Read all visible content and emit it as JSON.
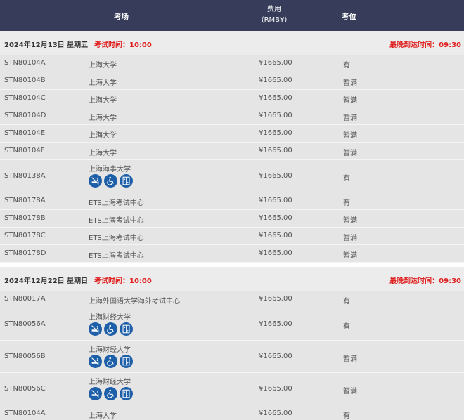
{
  "header": {
    "venue": "考场",
    "fee_line1": "费用",
    "fee_line2": "(RMB¥)",
    "seat": "考位"
  },
  "days": [
    {
      "date": "2024年12月13日 星期五",
      "exam_time": "考试时间：10:00",
      "latest_arrival": "最晚到达时间：09:30",
      "rows": [
        {
          "code": "STN80104A",
          "venue": "上海大学",
          "fee": "¥1665.00",
          "seat": "有",
          "icons": []
        },
        {
          "code": "STN80104B",
          "venue": "上海大学",
          "fee": "¥1665.00",
          "seat": "暂满",
          "icons": []
        },
        {
          "code": "STN80104C",
          "venue": "上海大学",
          "fee": "¥1665.00",
          "seat": "暂满",
          "icons": []
        },
        {
          "code": "STN80104D",
          "venue": "上海大学",
          "fee": "¥1665.00",
          "seat": "暂满",
          "icons": []
        },
        {
          "code": "STN80104E",
          "venue": "上海大学",
          "fee": "¥1665.00",
          "seat": "暂满",
          "icons": []
        },
        {
          "code": "STN80104F",
          "venue": "上海大学",
          "fee": "¥1665.00",
          "seat": "暂满",
          "icons": []
        },
        {
          "code": "STN80138A",
          "venue": "上海海事大学",
          "fee": "¥1665.00",
          "seat": "有",
          "icons": [
            "no-smoking-icon",
            "wheelchair-icon",
            "elevator-icon"
          ]
        },
        {
          "code": "STN80178A",
          "venue": "ETS上海考试中心",
          "fee": "¥1665.00",
          "seat": "有",
          "icons": []
        },
        {
          "code": "STN80178B",
          "venue": "ETS上海考试中心",
          "fee": "¥1665.00",
          "seat": "暂满",
          "icons": []
        },
        {
          "code": "STN80178C",
          "venue": "ETS上海考试中心",
          "fee": "¥1665.00",
          "seat": "暂满",
          "icons": []
        },
        {
          "code": "STN80178D",
          "venue": "ETS上海考试中心",
          "fee": "¥1665.00",
          "seat": "暂满",
          "icons": []
        }
      ]
    },
    {
      "date": "2024年12月22日 星期日",
      "exam_time": "考试时间：10:00",
      "latest_arrival": "最晚到达时间：09:30",
      "rows": [
        {
          "code": "STN80017A",
          "venue": "上海外国语大学海外考试中心",
          "fee": "¥1665.00",
          "seat": "有",
          "icons": []
        },
        {
          "code": "STN80056A",
          "venue": "上海财经大学",
          "fee": "¥1665.00",
          "seat": "有",
          "icons": [
            "no-smoking-icon",
            "wheelchair-icon",
            "elevator-icon"
          ]
        },
        {
          "code": "STN80056B",
          "venue": "上海财经大学",
          "fee": "¥1665.00",
          "seat": "暂满",
          "icons": [
            "no-smoking-icon",
            "wheelchair-icon",
            "elevator-icon"
          ]
        },
        {
          "code": "STN80056C",
          "venue": "上海财经大学",
          "fee": "¥1665.00",
          "seat": "暂满",
          "icons": [
            "no-smoking-icon",
            "wheelchair-icon",
            "elevator-icon"
          ]
        },
        {
          "code": "STN80104A",
          "venue": "上海大学",
          "fee": "¥1665.00",
          "seat": "有",
          "icons": []
        }
      ]
    }
  ],
  "colors": {
    "header_bg": "#363c5a",
    "row_bg": "#e5e5e5",
    "day_bg": "#ececec",
    "alert_red": "#e02020",
    "icon_blue": "#1d5fa8"
  }
}
